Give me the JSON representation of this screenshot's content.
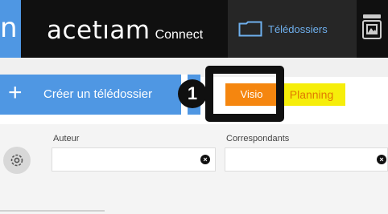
{
  "header": {
    "logo_glyph": "n",
    "brand_name": "acetıam",
    "brand_sub": "Connect",
    "nav_tab_label": "Télédossiers",
    "side_icon": "image-frame-icon"
  },
  "toolbar": {
    "create_plus": "+",
    "create_label": "Créer un télédossier",
    "step_badge": "1",
    "visio_label": "Visio",
    "planning_label": "Planning"
  },
  "filters": {
    "settings_icon": "gear-icon",
    "author_label": "Auteur",
    "author_value": "",
    "correspondents_label": "Correspondants",
    "correspondents_value": "",
    "clear_glyph": "×"
  },
  "colors": {
    "accent_blue": "#4f97e3",
    "header_bg": "#101010",
    "visio_orange": "#f5860f",
    "planning_yellow": "#f6ee0a",
    "tab_text": "#6fb0ee"
  }
}
